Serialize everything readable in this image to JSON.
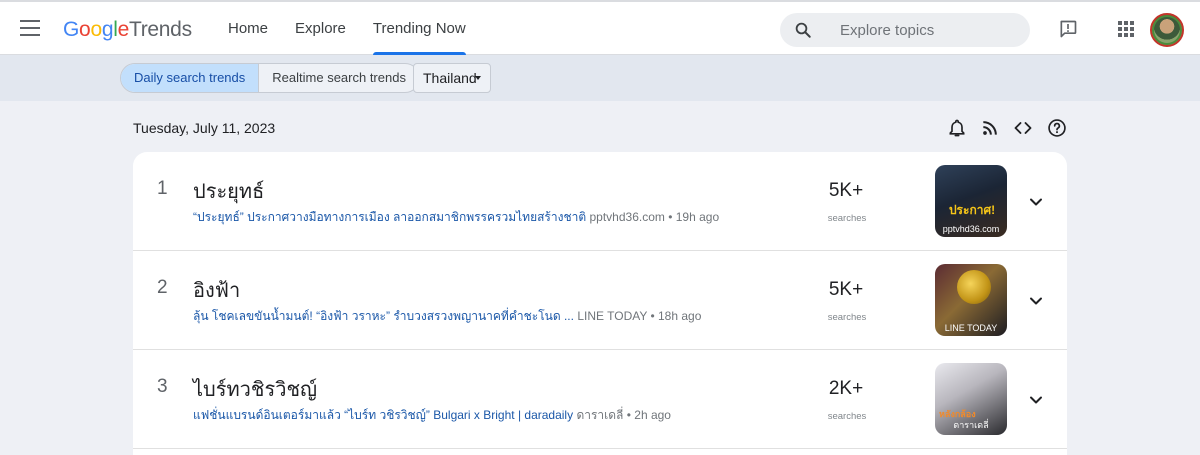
{
  "header": {
    "logo_google": [
      "G",
      "o",
      "o",
      "g",
      "l",
      "e"
    ],
    "logo_trends": "Trends",
    "nav": [
      {
        "label": "Home",
        "active": false
      },
      {
        "label": "Explore",
        "active": false
      },
      {
        "label": "Trending Now",
        "active": true
      }
    ],
    "search_placeholder": "Explore topics",
    "icons": [
      "menu-icon",
      "search-icon",
      "feedback-icon",
      "apps-icon",
      "avatar"
    ]
  },
  "subbar": {
    "tabs": [
      {
        "label": "Daily search trends",
        "selected": true
      },
      {
        "label": "Realtime search trends",
        "selected": false
      }
    ],
    "country": "Thailand"
  },
  "toolbar": {
    "date": "Tuesday, July 11, 2023",
    "icons": [
      "notifications-icon",
      "rss-icon",
      "embed-code-icon",
      "help-icon"
    ]
  },
  "colors": {
    "accent": "#1a73e8",
    "link": "#1a57a8",
    "selected_tab_bg": "#c2dffc",
    "page_bg": "#eef0f5"
  },
  "trends": [
    {
      "rank": "1",
      "title": "ประยุทธ์",
      "article_title": "“ประยุทธ์” ประกาศวางมือทางการเมือง ลาออกสมาชิกพรรครวมไทยสร้างชาติ",
      "source_time": "pptvhd36.com • 19h ago",
      "count": "5K+",
      "count_label": "searches",
      "thumb_source": "pptvhd36.com",
      "thumb_caption": "ประกาศ!"
    },
    {
      "rank": "2",
      "title": "อิงฟ้า",
      "article_title": "ลุ้น โชคเลขขันน้ำมนต์! “อิงฟ้า วราหะ” รำบวงสรวงพญานาคที่คำชะโนด ...",
      "source_time": "LINE TODAY • 18h ago",
      "count": "5K+",
      "count_label": "searches",
      "thumb_source": "LINE TODAY"
    },
    {
      "rank": "3",
      "title": "ไบร์ทวชิรวิชญ์",
      "article_title": "แฟชั่นแบรนด์อินเตอร์มาแล้ว “ไบร์ท วชิรวิชญ์” Bulgari x Bright | daradaily",
      "source_time": "ดาราเดลี่ • 2h ago",
      "count": "2K+",
      "count_label": "searches",
      "thumb_source": "ดาราเดลี่",
      "thumb_caption": "หลังกล้อง"
    }
  ]
}
